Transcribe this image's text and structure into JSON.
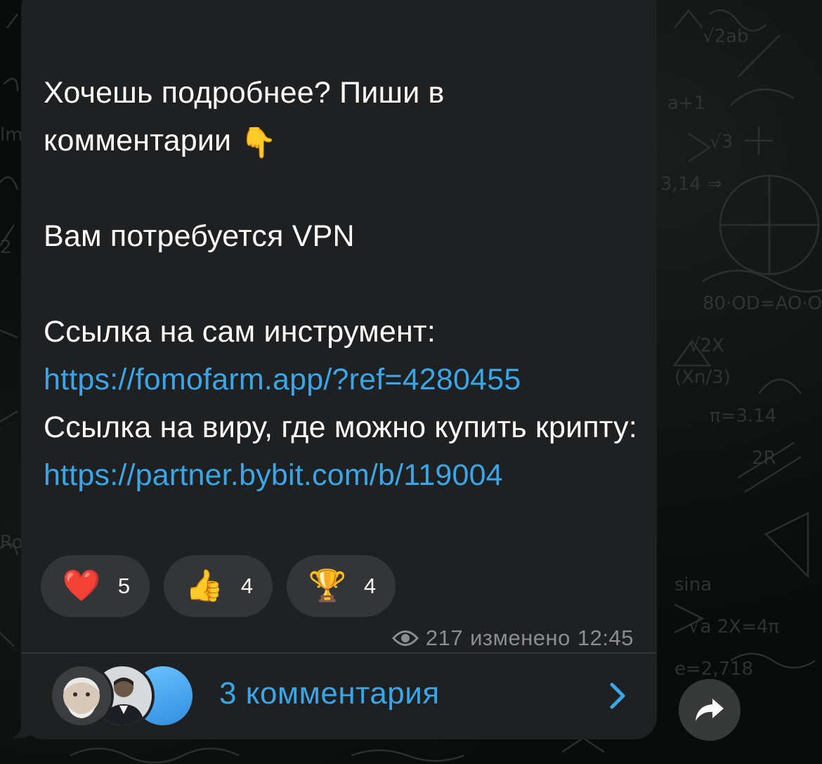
{
  "message": {
    "paragraph1": "Хочешь подробнее? Пиши в комментарии",
    "paragraph1_emoji": "👇",
    "paragraph2": "Вам потребуется VPN",
    "tool_link_label": "Ссылка на сам инструмент: ",
    "tool_link_url": "https://fomofarm.app/?ref=4280455",
    "exchange_link_label": "Ссылка на виру, где можно купить крипту: ",
    "exchange_link_url": "https://partner.bybit.com/b/119004"
  },
  "reactions": [
    {
      "emoji": "❤️",
      "count": "5"
    },
    {
      "emoji": "👍",
      "count": "4"
    },
    {
      "emoji": "🏆",
      "count": "4"
    }
  ],
  "meta": {
    "views": "217",
    "status": "изменено",
    "time": "12:45"
  },
  "comments": {
    "label": "3 комментария"
  },
  "colors": {
    "bubble": "#1f2021",
    "link": "#3aa6e8",
    "meta": "#8b8d90",
    "reaction_bg": "#333536"
  },
  "icons": {
    "views": "eye-icon",
    "chevron": "chevron-right-icon",
    "share": "share-arrow-icon"
  }
}
